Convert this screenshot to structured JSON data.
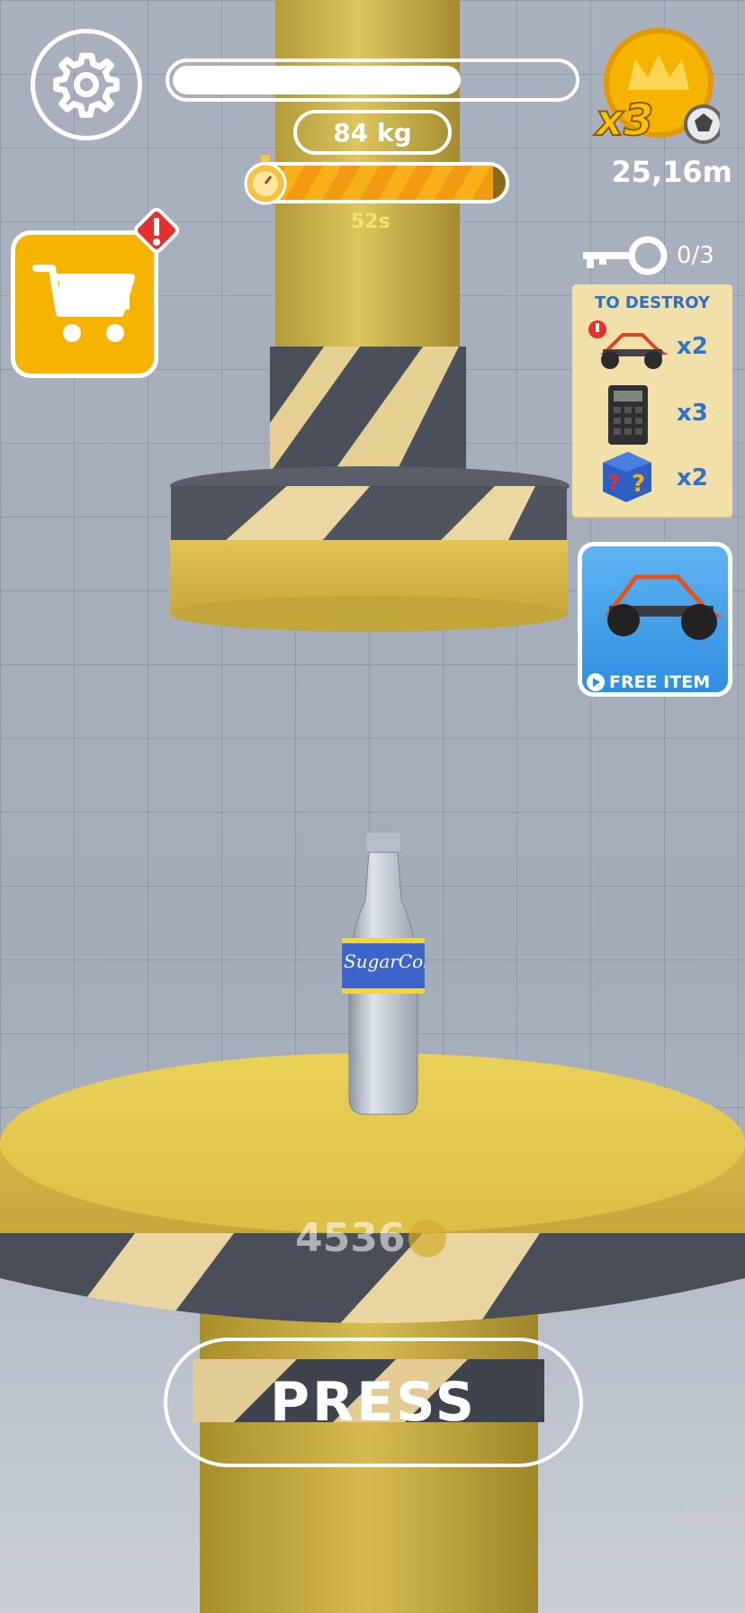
{
  "hud": {
    "settings_icon": "gear-icon",
    "progress_fraction": 0.72,
    "weight_label": "84 kg",
    "timer_fraction": 0.95,
    "timer_text": "52s",
    "coin_multiplier": "x3",
    "distance": "25,16m"
  },
  "shop": {
    "icon": "cart-icon",
    "alert_icon": "exclamation-icon"
  },
  "keys": {
    "icon": "key-icon",
    "count": "0/3"
  },
  "mission": {
    "title": "TO DESTROY",
    "items": [
      {
        "name": "buggy-toy",
        "count": "x2"
      },
      {
        "name": "calculator",
        "count": "x3"
      },
      {
        "name": "mystery-cube",
        "count": "x2"
      }
    ]
  },
  "offer": {
    "label": "FREE ITEM",
    "icon": "play-icon"
  },
  "bottle": {
    "brand": "SugarCola"
  },
  "platform": {
    "score": "4536"
  },
  "press_button": {
    "label": "PRESS"
  },
  "colors": {
    "accent_yellow": "#f5b400",
    "stripe_dark": "#4b4f59",
    "offer_blue": "#2f8fe0",
    "timer_orange": "#f08c12"
  }
}
